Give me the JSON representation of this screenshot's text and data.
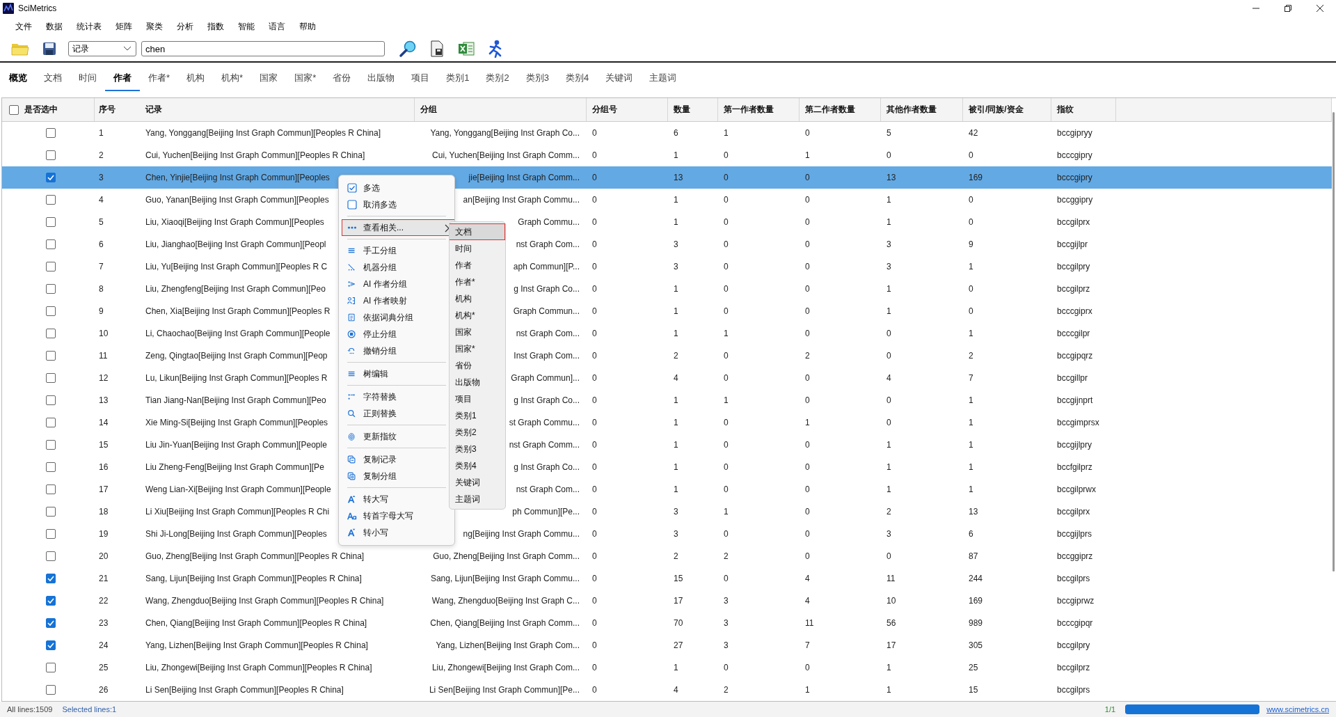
{
  "window": {
    "title": "SciMetrics"
  },
  "menu_bar": [
    "文件",
    "数据",
    "统计表",
    "矩阵",
    "聚类",
    "分析",
    "指数",
    "智能",
    "语言",
    "帮助"
  ],
  "toolbar": {
    "field_dropdown": "记录",
    "search": "chen"
  },
  "tabs": [
    {
      "label": "概览",
      "selected": false
    },
    {
      "label": "文档",
      "selected": false
    },
    {
      "label": "时间",
      "selected": false
    },
    {
      "label": "作者",
      "selected": true
    },
    {
      "label": "作者*",
      "selected": false
    },
    {
      "label": "机构",
      "selected": false
    },
    {
      "label": "机构*",
      "selected": false
    },
    {
      "label": "国家",
      "selected": false
    },
    {
      "label": "国家*",
      "selected": false
    },
    {
      "label": "省份",
      "selected": false
    },
    {
      "label": "出版物",
      "selected": false
    },
    {
      "label": "项目",
      "selected": false
    },
    {
      "label": "类别1",
      "selected": false
    },
    {
      "label": "类别2",
      "selected": false
    },
    {
      "label": "类别3",
      "selected": false
    },
    {
      "label": "类别4",
      "selected": false
    },
    {
      "label": "关键词",
      "selected": false
    },
    {
      "label": "主题词",
      "selected": false
    }
  ],
  "table": {
    "select_all": {
      "label": "是否选中",
      "checked": false
    },
    "columns": [
      {
        "label": "序号"
      },
      {
        "label": "记录"
      },
      {
        "label": "分组"
      },
      {
        "label": "分组号"
      },
      {
        "label": "数量"
      },
      {
        "label": "第一作者数量"
      },
      {
        "label": "第二作者数量"
      },
      {
        "label": "其他作者数量"
      },
      {
        "label": "被引/同族/资金"
      },
      {
        "label": "指纹"
      }
    ],
    "rows": [
      {
        "checked": false,
        "selected": false,
        "cells": [
          "1",
          "Yang, Yonggang[Beijing Inst Graph Commun][Peoples R China]",
          "Yang, Yonggang[Beijing Inst Graph Co...",
          "0",
          "6",
          "1",
          "0",
          "5",
          "42",
          "bccgipryy"
        ]
      },
      {
        "checked": false,
        "selected": false,
        "cells": [
          "2",
          "Cui, Yuchen[Beijing Inst Graph Commun][Peoples R China]",
          "Cui, Yuchen[Beijing Inst Graph Comm...",
          "0",
          "1",
          "0",
          "1",
          "0",
          "0",
          "bcccgipry"
        ]
      },
      {
        "checked": true,
        "selected": true,
        "cells": [
          "3",
          "Chen, Yinjie[Beijing Inst Graph Commun][Peoples",
          "jie[Beijing Inst Graph Comm...",
          "0",
          "13",
          "0",
          "0",
          "13",
          "169",
          "bcccgipry"
        ]
      },
      {
        "checked": false,
        "selected": false,
        "cells": [
          "4",
          "Guo, Yanan[Beijing Inst Graph Commun][Peoples",
          "an[Beijing Inst Graph Commu...",
          "0",
          "1",
          "0",
          "0",
          "1",
          "0",
          "bccggipry"
        ]
      },
      {
        "checked": false,
        "selected": false,
        "cells": [
          "5",
          "Liu, Xiaoqi[Beijing Inst Graph Commun][Peoples",
          "Graph Commu...",
          "0",
          "1",
          "0",
          "0",
          "1",
          "0",
          "bccgilprx"
        ]
      },
      {
        "checked": false,
        "selected": false,
        "cells": [
          "6",
          "Liu, Jianghao[Beijing Inst Graph Commun][Peopl",
          "nst Graph Com...",
          "0",
          "3",
          "0",
          "0",
          "3",
          "9",
          "bccgijlpr"
        ]
      },
      {
        "checked": false,
        "selected": false,
        "cells": [
          "7",
          "Liu, Yu[Beijing Inst Graph Commun][Peoples R C",
          "aph Commun][P...",
          "0",
          "3",
          "0",
          "0",
          "3",
          "1",
          "bccgilpry"
        ]
      },
      {
        "checked": false,
        "selected": false,
        "cells": [
          "8",
          "Liu, Zhengfeng[Beijing Inst Graph Commun][Peo",
          "g Inst Graph Co...",
          "0",
          "1",
          "0",
          "0",
          "1",
          "0",
          "bccgilprz"
        ]
      },
      {
        "checked": false,
        "selected": false,
        "cells": [
          "9",
          "Chen, Xia[Beijing Inst Graph Commun][Peoples R",
          "Graph Commun...",
          "0",
          "1",
          "0",
          "0",
          "1",
          "0",
          "bcccgiprx"
        ]
      },
      {
        "checked": false,
        "selected": false,
        "cells": [
          "10",
          "Li, Chaochao[Beijing Inst Graph Commun][People",
          "nst Graph Com...",
          "0",
          "1",
          "1",
          "0",
          "0",
          "1",
          "bcccgilpr"
        ]
      },
      {
        "checked": false,
        "selected": false,
        "cells": [
          "11",
          "Zeng, Qingtao[Beijing Inst Graph Commun][Peop",
          "Inst Graph Com...",
          "0",
          "2",
          "0",
          "2",
          "0",
          "2",
          "bccgipqrz"
        ]
      },
      {
        "checked": false,
        "selected": false,
        "cells": [
          "12",
          "Lu, Likun[Beijing Inst Graph Commun][Peoples R",
          "Graph Commun]...",
          "0",
          "4",
          "0",
          "0",
          "4",
          "7",
          "bccgillpr"
        ]
      },
      {
        "checked": false,
        "selected": false,
        "cells": [
          "13",
          "Tian Jiang-Nan[Beijing Inst Graph Commun][Peo",
          "g Inst Graph Co...",
          "0",
          "1",
          "1",
          "0",
          "0",
          "1",
          "bccgijnprt"
        ]
      },
      {
        "checked": false,
        "selected": false,
        "cells": [
          "14",
          "Xie Ming-Si[Beijing Inst Graph Commun][Peoples",
          "st Graph Commu...",
          "0",
          "1",
          "0",
          "1",
          "0",
          "1",
          "bccgimprsx"
        ]
      },
      {
        "checked": false,
        "selected": false,
        "cells": [
          "15",
          "Liu Jin-Yuan[Beijing Inst Graph Commun][People",
          "nst Graph Comm...",
          "0",
          "1",
          "0",
          "0",
          "1",
          "1",
          "bccgijlpry"
        ]
      },
      {
        "checked": false,
        "selected": false,
        "cells": [
          "16",
          "Liu Zheng-Feng[Beijing Inst Graph Commun][Pe",
          "g Inst Graph Co...",
          "0",
          "1",
          "0",
          "0",
          "1",
          "1",
          "bccfgilprz"
        ]
      },
      {
        "checked": false,
        "selected": false,
        "cells": [
          "17",
          "Weng Lian-Xi[Beijing Inst Graph Commun][People",
          "nst Graph Com...",
          "0",
          "1",
          "0",
          "0",
          "1",
          "1",
          "bccgilprwx"
        ]
      },
      {
        "checked": false,
        "selected": false,
        "cells": [
          "18",
          "Li Xiu[Beijing Inst Graph Commun][Peoples R Chi",
          "ph Commun][Pe...",
          "0",
          "3",
          "1",
          "0",
          "2",
          "13",
          "bccgilprx"
        ]
      },
      {
        "checked": false,
        "selected": false,
        "cells": [
          "19",
          "Shi Ji-Long[Beijing Inst Graph Commun][Peoples",
          "ng[Beijing Inst Graph Commu...",
          "0",
          "3",
          "0",
          "0",
          "3",
          "6",
          "bccgijlprs"
        ]
      },
      {
        "checked": false,
        "selected": false,
        "cells": [
          "20",
          "Guo, Zheng[Beijing Inst Graph Commun][Peoples R China]",
          "Guo, Zheng[Beijing Inst Graph Comm...",
          "0",
          "2",
          "2",
          "0",
          "0",
          "87",
          "bccggiprz"
        ]
      },
      {
        "checked": true,
        "selected": false,
        "cells": [
          "21",
          "Sang, Lijun[Beijing Inst Graph Commun][Peoples R China]",
          "Sang, Lijun[Beijing Inst Graph Commu...",
          "0",
          "15",
          "0",
          "4",
          "11",
          "244",
          "bccgilprs"
        ]
      },
      {
        "checked": true,
        "selected": false,
        "cells": [
          "22",
          "Wang, Zhengduo[Beijing Inst Graph Commun][Peoples R China]",
          "Wang, Zhengduo[Beijing Inst Graph C...",
          "0",
          "17",
          "3",
          "4",
          "10",
          "169",
          "bccgiprwz"
        ]
      },
      {
        "checked": true,
        "selected": false,
        "cells": [
          "23",
          "Chen, Qiang[Beijing Inst Graph Commun][Peoples R China]",
          "Chen, Qiang[Beijing Inst Graph Comm...",
          "0",
          "70",
          "3",
          "11",
          "56",
          "989",
          "bcccgipqr"
        ]
      },
      {
        "checked": true,
        "selected": false,
        "cells": [
          "24",
          "Yang, Lizhen[Beijing Inst Graph Commun][Peoples R China]",
          "Yang, Lizhen[Beijing Inst Graph Com...",
          "0",
          "27",
          "3",
          "7",
          "17",
          "305",
          "bccgilpry"
        ]
      },
      {
        "checked": false,
        "selected": false,
        "cells": [
          "25",
          "Liu, Zhongewi[Beijing Inst Graph Commun][Peoples R China]",
          "Liu, Zhongewi[Beijing Inst Graph Com...",
          "0",
          "1",
          "0",
          "0",
          "1",
          "25",
          "bccgilprz"
        ]
      },
      {
        "checked": false,
        "selected": false,
        "cells": [
          "26",
          "Li Sen[Beijing Inst Graph Commun][Peoples R China]",
          "Li Sen[Beijing Inst Graph Commun][Pe...",
          "0",
          "4",
          "2",
          "1",
          "1",
          "15",
          "bccgilprs"
        ]
      }
    ]
  },
  "context_menu": {
    "groups": [
      {
        "items": [
          {
            "label": "多选",
            "kind": "checkbox",
            "checked": true,
            "selected": false
          },
          {
            "label": "取消多选",
            "kind": "checkbox",
            "checked": false,
            "selected": false
          }
        ]
      },
      {
        "items": [
          {
            "label": "查看相关...",
            "kind": "submenu",
            "selected": true
          }
        ]
      },
      {
        "items": [
          {
            "label": "手工分组",
            "kind": "command",
            "selected": false
          },
          {
            "label": "机器分组",
            "kind": "command",
            "selected": false
          },
          {
            "label": "AI 作者分组",
            "kind": "command",
            "selected": false
          },
          {
            "label": "AI 作者映射",
            "kind": "command",
            "selected": false
          },
          {
            "label": "依据词典分组",
            "kind": "command",
            "selected": false
          },
          {
            "label": "停止分组",
            "kind": "command",
            "selected": false
          },
          {
            "label": "撤销分组",
            "kind": "command",
            "selected": false
          }
        ]
      },
      {
        "items": [
          {
            "label": "树编辑",
            "kind": "command",
            "selected": false
          }
        ]
      },
      {
        "items": [
          {
            "label": "字符替换",
            "kind": "command",
            "selected": false
          },
          {
            "label": "正则替换",
            "kind": "command",
            "selected": false
          }
        ]
      },
      {
        "items": [
          {
            "label": "更新指纹",
            "kind": "command",
            "selected": false
          }
        ]
      },
      {
        "items": [
          {
            "label": "复制记录",
            "kind": "command",
            "selected": false
          },
          {
            "label": "复制分组",
            "kind": "command",
            "selected": false
          }
        ]
      },
      {
        "items": [
          {
            "label": "转大写",
            "kind": "command",
            "selected": false
          },
          {
            "label": "转首字母大写",
            "kind": "command",
            "selected": false
          },
          {
            "label": "转小写",
            "kind": "command",
            "selected": false
          }
        ]
      }
    ]
  },
  "submenu": {
    "items": [
      {
        "label": "文档",
        "selected": true
      },
      {
        "label": "时间",
        "selected": false
      },
      {
        "label": "作者",
        "selected": false
      },
      {
        "label": "作者*",
        "selected": false
      },
      {
        "label": "机构",
        "selected": false
      },
      {
        "label": "机构*",
        "selected": false
      },
      {
        "label": "国家",
        "selected": false
      },
      {
        "label": "国家*",
        "selected": false
      },
      {
        "label": "省份",
        "selected": false
      },
      {
        "label": "出版物",
        "selected": false
      },
      {
        "label": "项目",
        "selected": false
      },
      {
        "label": "类别1",
        "selected": false
      },
      {
        "label": "类别2",
        "selected": false
      },
      {
        "label": "类别3",
        "selected": false
      },
      {
        "label": "类别4",
        "selected": false
      },
      {
        "label": "关键词",
        "selected": false
      },
      {
        "label": "主题词",
        "selected": false
      }
    ]
  },
  "status_bar": {
    "all_lines": "All lines:1509",
    "selected_lines": "Selected lines:1",
    "page": "1/1",
    "progress": {
      "level": 1
    },
    "link": "www.scimetrics.cn"
  }
}
